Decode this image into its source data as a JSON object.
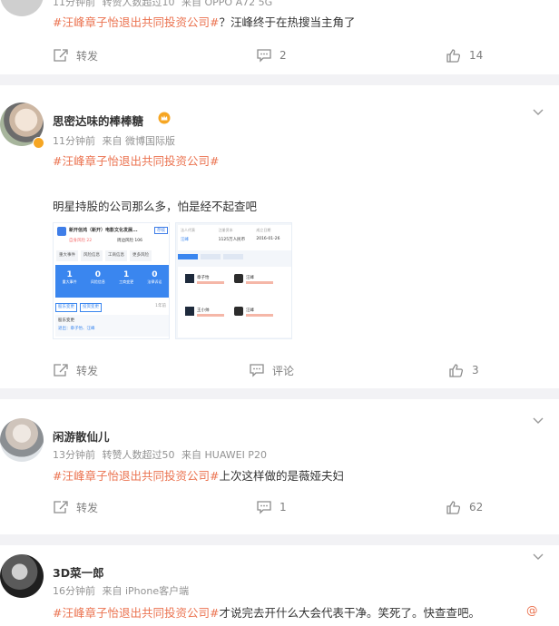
{
  "posts": [
    {
      "meta": {
        "time": "11分钟前",
        "repost": "转赞人数超过10",
        "source": "来自 OPPO A72 5G"
      },
      "content": {
        "topic": "#汪峰章子怡退出共同投资公司#",
        "text": "？汪峰终于在热搜当主角了"
      },
      "actions": {
        "repost": "转发",
        "comment": "2",
        "like": "14"
      }
    },
    {
      "user": "思密达味的棒棒糖",
      "meta": {
        "time": "11分钟前",
        "source": "来自 微博国际版"
      },
      "content": {
        "topic": "#汪峰章子怡退出共同投资公司#",
        "text": "明星持股的公司那么多，怕是经不起查吧"
      },
      "images": {
        "a": {
          "title": "新开信鸿（新开）电影文化发展...",
          "tag": "存续",
          "stat1": "自身风险 22",
          "stat2": "周边风险 106",
          "tab1": "重大事件",
          "tab2": "风险信息",
          "tab3": "工商信息",
          "tab4": "更多风险",
          "n1": "1",
          "n2": "0",
          "n3": "1",
          "n4": "0",
          "l1": "重大事件",
          "l2": "风险信息",
          "l3": "工商变更",
          "l4": "法律诉讼",
          "tag2": "股东变更",
          "tag3": "投资变更",
          "info1": "1年前",
          "info2": "股东变更",
          "info3": "退出：章子怡、汪峰"
        },
        "b": {
          "tab1": "法人代表",
          "tab2": "注册资本",
          "tab3": "成立日期",
          "val1": "汪峰",
          "val2": "1125万人民币",
          "val3": "2016-01-26",
          "p1": "章子怡",
          "p2": "汪峰",
          "p3": "王小帅",
          "p4": "汪峰"
        }
      },
      "actions": {
        "repost": "转发",
        "comment": "评论",
        "like": "3"
      }
    },
    {
      "user": "闲游散仙儿",
      "meta": {
        "time": "13分钟前",
        "repost": "转赞人数超过50",
        "source": "来自 HUAWEI P20"
      },
      "content": {
        "topic": "#汪峰章子怡退出共同投资公司#",
        "text": "上次这样做的是薇娅夫妇"
      },
      "actions": {
        "repost": "转发",
        "comment": "1",
        "like": "62"
      }
    },
    {
      "user": "3D菜一郎",
      "meta": {
        "time": "16分钟前",
        "source": "来自 iPhone客户端"
      },
      "content": {
        "topic": "#汪峰章子怡退出共同投资公司#",
        "text": "才说完去开什么大会代表干净。笑死了。快查查吧。",
        "at": "@"
      }
    }
  ],
  "colors": {
    "topic": "#eb7350",
    "meta": "#939393",
    "vbadge": "#f6a623"
  }
}
